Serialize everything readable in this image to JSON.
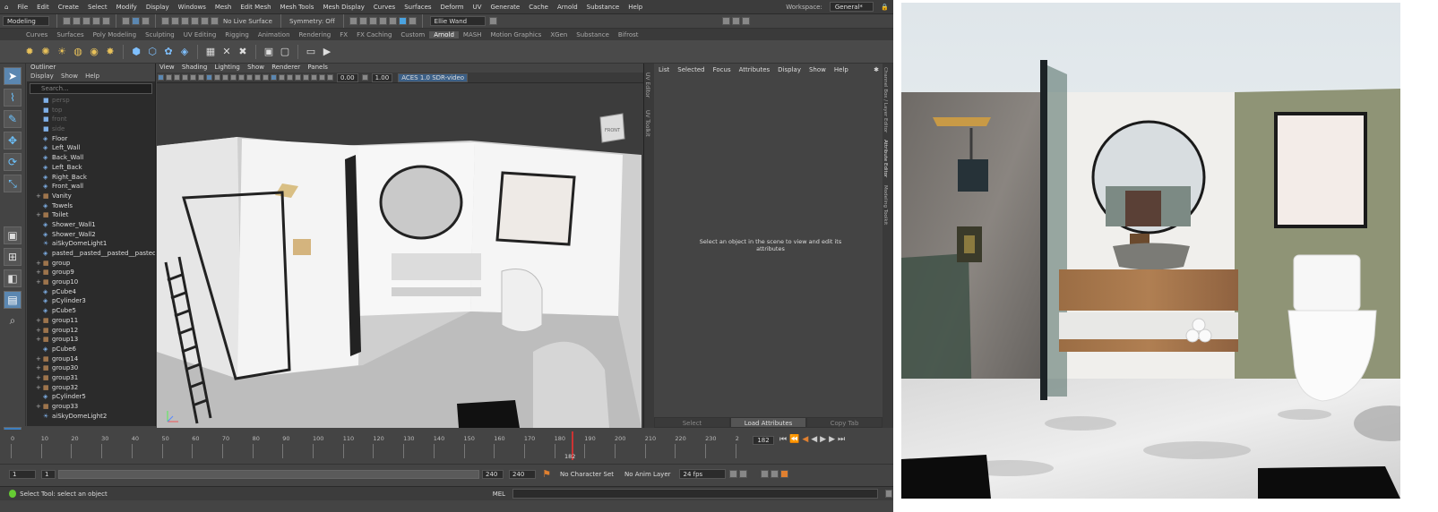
{
  "menubar": {
    "items": [
      "File",
      "Edit",
      "Create",
      "Select",
      "Modify",
      "Display",
      "Windows",
      "Mesh",
      "Edit Mesh",
      "Mesh Tools",
      "Mesh Display",
      "Curves",
      "Surfaces",
      "Deform",
      "UV",
      "Generate",
      "Cache",
      "Arnold",
      "Substance",
      "Help"
    ],
    "workspace_label": "Workspace:",
    "workspace_value": "General*"
  },
  "statusline": {
    "mode": "Modeling",
    "live_surface": "No Live Surface",
    "symmetry": "Symmetry: Off",
    "quick": "Ellie Wand"
  },
  "shelf": {
    "tabs": [
      "Curves",
      "Surfaces",
      "Poly Modeling",
      "Sculpting",
      "UV Editing",
      "Rigging",
      "Animation",
      "Rendering",
      "FX",
      "FX Caching",
      "Custom",
      "Arnold",
      "MASH",
      "Motion Graphics",
      "XGen",
      "Substance",
      "Bifrost"
    ],
    "active_tab": "Arnold"
  },
  "outliner": {
    "title": "Outliner",
    "menu": [
      "Display",
      "Show",
      "Help"
    ],
    "search_placeholder": "Search...",
    "items": [
      {
        "label": "persp",
        "type": "cam"
      },
      {
        "label": "top",
        "type": "cam"
      },
      {
        "label": "front",
        "type": "cam"
      },
      {
        "label": "side",
        "type": "cam"
      },
      {
        "label": "Floor",
        "type": "mesh"
      },
      {
        "label": "Left_Wall",
        "type": "mesh"
      },
      {
        "label": "Back_Wall",
        "type": "mesh"
      },
      {
        "label": "Left_Back",
        "type": "mesh"
      },
      {
        "label": "Right_Back",
        "type": "mesh"
      },
      {
        "label": "Front_wall",
        "type": "mesh"
      },
      {
        "label": "Vanity",
        "type": "grp"
      },
      {
        "label": "Towels",
        "type": "mesh"
      },
      {
        "label": "Toilet",
        "type": "grp"
      },
      {
        "label": "Shower_Wall1",
        "type": "mesh"
      },
      {
        "label": "Shower_Wall2",
        "type": "mesh"
      },
      {
        "label": "aiSkyDomeLight1",
        "type": "light"
      },
      {
        "label": "pasted__pasted__pasted__pasted__p",
        "type": "mesh"
      },
      {
        "label": "group",
        "type": "grp"
      },
      {
        "label": "group9",
        "type": "grp"
      },
      {
        "label": "group10",
        "type": "grp"
      },
      {
        "label": "pCube4",
        "type": "mesh"
      },
      {
        "label": "pCylinder3",
        "type": "mesh"
      },
      {
        "label": "pCube5",
        "type": "mesh"
      },
      {
        "label": "group11",
        "type": "grp"
      },
      {
        "label": "group12",
        "type": "grp"
      },
      {
        "label": "group13",
        "type": "grp"
      },
      {
        "label": "pCube6",
        "type": "mesh"
      },
      {
        "label": "group14",
        "type": "grp"
      },
      {
        "label": "group30",
        "type": "grp"
      },
      {
        "label": "group31",
        "type": "grp"
      },
      {
        "label": "group32",
        "type": "grp"
      },
      {
        "label": "pCylinder5",
        "type": "mesh"
      },
      {
        "label": "group33",
        "type": "grp"
      },
      {
        "label": "aiSkyDomeLight2",
        "type": "light"
      }
    ]
  },
  "viewport": {
    "menu": [
      "View",
      "Shading",
      "Lighting",
      "Show",
      "Renderer",
      "Panels"
    ],
    "field_a": "0.00",
    "field_b": "1.00",
    "colorspace": "ACES 1.0 SDR-video",
    "viewcube_label": "FRONT"
  },
  "side_tabs": [
    "UV Editor",
    "UV Toolkit"
  ],
  "attribute_editor": {
    "menu": [
      "List",
      "Selected",
      "Focus",
      "Attributes",
      "Display",
      "Show",
      "Help"
    ],
    "message": "Select an object in the scene to view and edit its attributes",
    "buttons": [
      "Select",
      "Load Attributes",
      "Copy Tab"
    ]
  },
  "right_tabs": [
    "Channel Box / Layer Editor",
    "Attribute Editor",
    "Modeling Toolkit"
  ],
  "timeline": {
    "ticks": [
      "0",
      "10",
      "20",
      "30",
      "40",
      "50",
      "60",
      "70",
      "80",
      "90",
      "100",
      "110",
      "120",
      "130",
      "140",
      "150",
      "160",
      "170",
      "180",
      "190",
      "200",
      "210",
      "220",
      "230",
      "2"
    ],
    "current_frame": "182",
    "playhead_label": "182"
  },
  "range": {
    "start": "1",
    "start_inner": "1",
    "end_inner": "240",
    "end": "240",
    "end_outer": "240",
    "character_set": "No Character Set",
    "anim_layer": "No Anim Layer",
    "fps": "24 fps"
  },
  "helpline": {
    "text": "Select Tool: select an object",
    "mel_label": "MEL"
  },
  "colors": {
    "maya_bg": "#444444",
    "viewport_walls": "#f2f2f2",
    "accent": "#5b87b1",
    "render_green": "#8f9476"
  }
}
